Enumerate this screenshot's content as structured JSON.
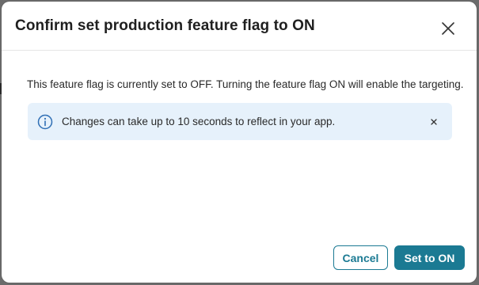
{
  "dialog": {
    "title": "Confirm set production feature flag to ON",
    "close_icon": "close-icon",
    "message": "This feature flag is currently set to OFF. Turning the feature flag ON will enable the targeting.",
    "info_banner": {
      "icon": "info-icon",
      "text": "Changes can take up to 10 seconds to reflect in your app.",
      "dismiss_label": "×"
    },
    "actions": {
      "cancel_label": "Cancel",
      "confirm_label": "Set to ON"
    }
  },
  "colors": {
    "accent": "#1b7a93",
    "info_background": "#e6f1fb",
    "info_icon": "#2f6fb5",
    "backdrop": "#6b6b6b"
  }
}
